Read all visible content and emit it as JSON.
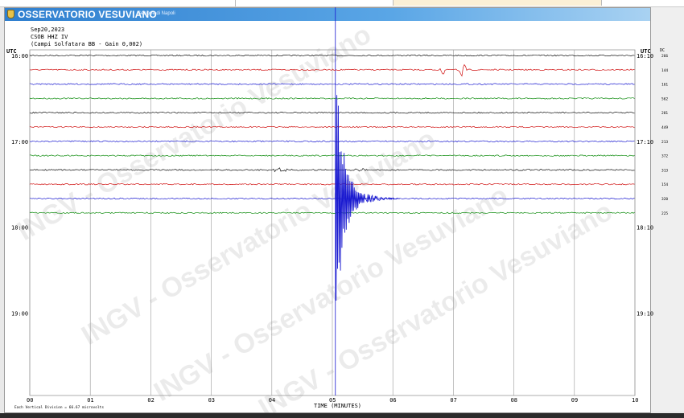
{
  "header": {
    "org": "OSSERVATORIO VESUVIANO",
    "subtitle": "Sezione di Napoli"
  },
  "info": {
    "date": "Sep20,2023",
    "station": "CSOB HHZ IV",
    "site": "(Campi Solfatara BB - Gain 0,002)"
  },
  "utc_label": "UTC",
  "dc_label": "DC",
  "watermark": "INGV - Osservatorio Vesuviano",
  "footer": {
    "scale": "Each Vertical Division =   66.67 microvolts"
  },
  "colors": {
    "black": "#111111",
    "red": "#d01010",
    "blue": "#1a1ad0",
    "green": "#0a8a0a",
    "grid": "#9a9a9a",
    "header": "#2f7fcf"
  },
  "chart_data": {
    "type": "line",
    "title": "",
    "xlabel": "TIME (MINUTES)",
    "ylabel": "",
    "xlim": [
      0,
      10
    ],
    "x_ticks": [
      "00",
      "01",
      "02",
      "03",
      "04",
      "05",
      "06",
      "07",
      "08",
      "09",
      "10"
    ],
    "left_time_labels": [
      "16:00",
      "17:00",
      "18:00",
      "19:00"
    ],
    "right_time_labels": [
      "16:10",
      "17:10",
      "18:10",
      "19:10"
    ],
    "traces": [
      {
        "dc": "266",
        "color": "black",
        "end_minute": 10
      },
      {
        "dc": "144",
        "color": "red",
        "end_minute": 10
      },
      {
        "dc": "161",
        "color": "blue",
        "end_minute": 10
      },
      {
        "dc": "562",
        "color": "green",
        "end_minute": 10
      },
      {
        "dc": "281",
        "color": "black",
        "end_minute": 10
      },
      {
        "dc": "449",
        "color": "red",
        "end_minute": 10
      },
      {
        "dc": "213",
        "color": "blue",
        "end_minute": 10
      },
      {
        "dc": "372",
        "color": "green",
        "end_minute": 10
      },
      {
        "dc": "313",
        "color": "black",
        "end_minute": 10
      },
      {
        "dc": "154",
        "color": "red",
        "end_minute": 10
      },
      {
        "dc": "320",
        "color": "blue",
        "end_minute": 10
      },
      {
        "dc": "225",
        "color": "green",
        "end_minute": 10
      }
    ],
    "events": [
      {
        "trace": 1,
        "minute": 6.85,
        "note": "spike"
      },
      {
        "trace": 1,
        "minute": 7.15,
        "note": "spike"
      },
      {
        "trace": 8,
        "minute": 4.15,
        "note": "small event"
      },
      {
        "trace": 8,
        "minute": 5.55,
        "note": "small event"
      },
      {
        "trace": 10,
        "minute": 5.05,
        "note": "earthquake"
      }
    ],
    "marker_minute": 5.05,
    "grid": true
  }
}
